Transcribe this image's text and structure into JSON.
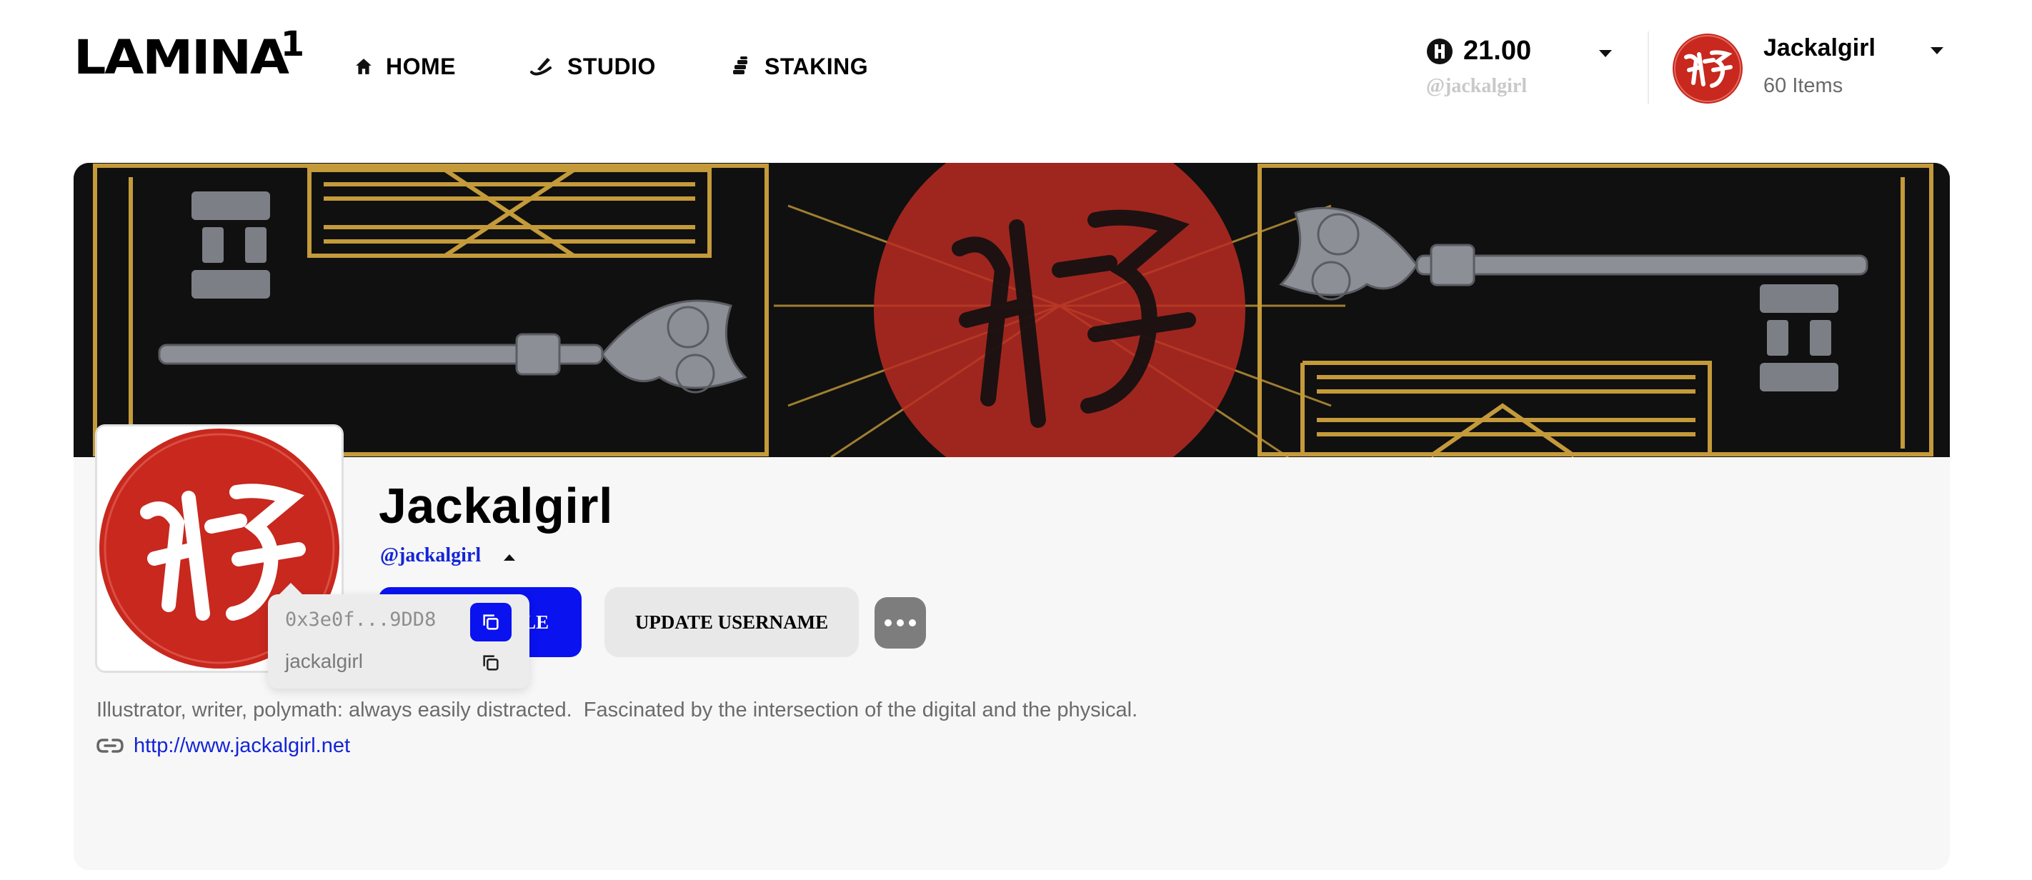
{
  "header": {
    "logo_text": "LAMINA",
    "logo_sup": "1",
    "nav": [
      {
        "label": "HOME",
        "icon": "home-icon"
      },
      {
        "label": "STUDIO",
        "icon": "studio-icon"
      },
      {
        "label": "STAKING",
        "icon": "staking-icon"
      }
    ],
    "balance": {
      "amount": "21.00",
      "handle": "@jackalgirl",
      "icon": "lamina-token-icon"
    },
    "account": {
      "name": "Jackalgirl",
      "items": "60 Items"
    }
  },
  "profile": {
    "name": "Jackalgirl",
    "handle": "@jackalgirl",
    "edit_button": "EDIT PROFILE",
    "username_button": "UPDATE USERNAME",
    "more_button_icon": "more-dots-icon",
    "popover": {
      "address": "0x3e0f...9DD8",
      "username": "jackalgirl"
    },
    "bio": "Illustrator, writer, polymath: always easily distracted.  Fascinated by the intersection of the digital and the physical.",
    "website": "http://www.jackalgirl.net"
  },
  "colors": {
    "accent_blue": "#0a12f0",
    "link_blue": "#1424d8",
    "seal_red": "#c8281e",
    "banner_gold": "#c49a3a"
  }
}
